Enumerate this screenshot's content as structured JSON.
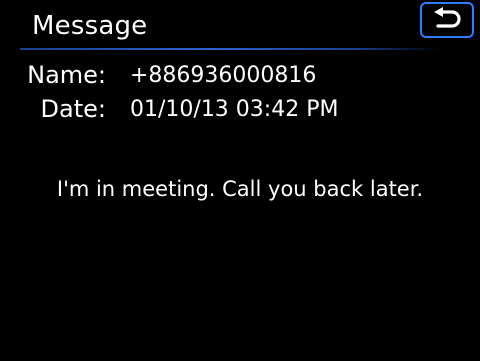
{
  "header": {
    "title": "Message",
    "back_icon": "return-arrow-icon",
    "accent_color": "#2f7bff"
  },
  "info": {
    "name_label": "Name:",
    "name_value": "+886936000816",
    "date_label": "Date:",
    "date_value": "01/10/13 03:42 PM"
  },
  "message": {
    "text": "I'm in meeting. Call you back later."
  }
}
